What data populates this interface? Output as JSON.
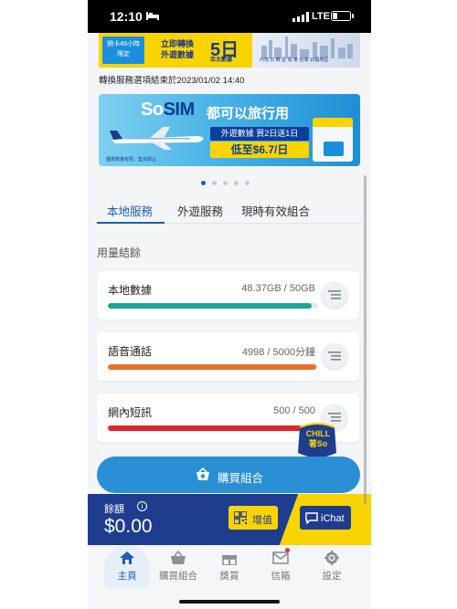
{
  "status_bar": {
    "time": "12:10",
    "network": "LTE"
  },
  "promo_top": {
    "badge_line1": "開卡48小時",
    "badge_line2": "限定",
    "cta_line1": "立即轉換",
    "cta_line2": "外遊數據",
    "days": "5日",
    "days_sub": "亞太數據",
    "cities": "內地 日 韓 星 馬 泰 台灣 10個地區"
  },
  "notice": "轉換服務選項結束於2023/01/02 14:40",
  "sosim_banner": {
    "brand_so": "So",
    "brand_sim": "SIM",
    "tagline": "都可以旅行用",
    "offer": "外遊數據 買2日送1日",
    "price": "低至$6.7/日",
    "footnote": "優惠數量有限，售完即止"
  },
  "carousel": {
    "count": 5,
    "active_index": 0
  },
  "tabs": [
    {
      "label": "本地服務",
      "active": true
    },
    {
      "label": "外遊服務",
      "active": false
    },
    {
      "label": "現時有效組合",
      "active": false
    }
  ],
  "section_label": "用量結餘",
  "usage": [
    {
      "name": "本地數據",
      "value": "48.37GB / 50GB",
      "fraction": 0.97,
      "color": "#1aa597"
    },
    {
      "name": "語音通話",
      "value": "4998 / 5000分鐘",
      "fraction": 0.99,
      "color": "#e8712a"
    },
    {
      "name": "網內短訊",
      "value": "500 / 500",
      "fraction": 1.0,
      "color": "#e0242f"
    }
  ],
  "chill_badge": {
    "line1": "CHILL",
    "line2": "著So"
  },
  "buy_button": {
    "label": "購買組合"
  },
  "balance": {
    "label": "餘額",
    "info": "i",
    "amount": "$0.00",
    "topup_label": "增值",
    "chat_label": "iChat"
  },
  "nav": [
    {
      "label": "主頁",
      "icon": "home-icon",
      "active": true
    },
    {
      "label": "購買組合",
      "icon": "basket-icon",
      "active": false
    },
    {
      "label": "獎賞",
      "icon": "gift-icon",
      "active": false
    },
    {
      "label": "信箱",
      "icon": "mail-icon",
      "active": false,
      "unread": true
    },
    {
      "label": "設定",
      "icon": "gear-icon",
      "active": false
    }
  ],
  "colors": {
    "brand_blue": "#1d5fb0",
    "brand_navy": "#1e3d8f",
    "brand_yellow": "#f9d400",
    "button_blue": "#2b8fd6"
  }
}
